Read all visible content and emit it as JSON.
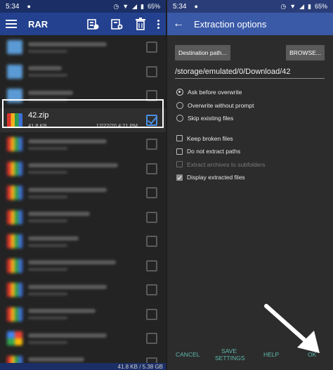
{
  "status": {
    "time": "5:34",
    "battery": "65%"
  },
  "left": {
    "app_title": "RAR",
    "selected_file": {
      "name": "42.zip",
      "size": "41.8 KB",
      "date": "12/22/20 4:21 PM"
    },
    "footer_text": "41.8 KB / 5.38 GB"
  },
  "right": {
    "title": "Extraction options",
    "destination_button": "Destination path...",
    "browse_button": "BROWSE...",
    "path": "/storage/emulated/0/Download/42",
    "overwrite_options": [
      {
        "label": "Ask before overwrite",
        "selected": true
      },
      {
        "label": "Overwrite without prompt",
        "selected": false
      },
      {
        "label": "Skip existing files",
        "selected": false
      }
    ],
    "checkboxes": [
      {
        "label": "Keep broken files",
        "checked": false,
        "enabled": true
      },
      {
        "label": "Do not extract paths",
        "checked": false,
        "enabled": true
      },
      {
        "label": "Extract archives to subfolders",
        "checked": false,
        "enabled": false
      },
      {
        "label": "Display extracted files",
        "checked": true,
        "enabled": true
      }
    ],
    "footer": {
      "cancel": "CANCEL",
      "save_line1": "SAVE",
      "save_line2": "SETTINGS",
      "help": "HELP",
      "ok": "OK"
    }
  },
  "colors": {
    "appbar_left": "#23418f",
    "appbar_right": "#3a5aa8",
    "accent_teal": "#5fb8ae"
  },
  "icons": [
    "menu-icon",
    "extract-icon",
    "add-archive-icon",
    "trash-icon",
    "more-icon",
    "back-arrow-icon",
    "checkmark-icon"
  ]
}
